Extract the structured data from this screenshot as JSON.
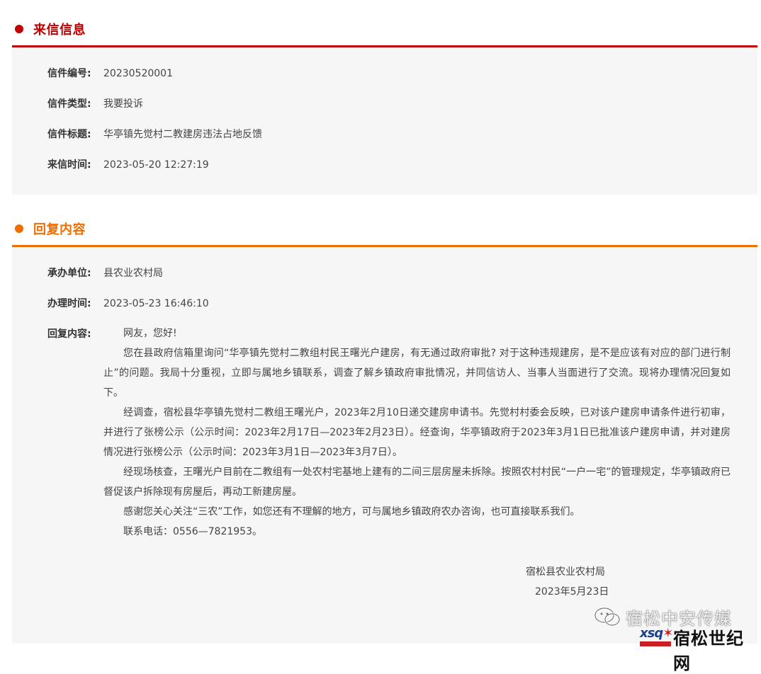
{
  "letter_section": {
    "title": "来信信息",
    "accent": "#c00000",
    "fields": [
      {
        "label": "信件编号:",
        "value": "20230520001"
      },
      {
        "label": "信件类型:",
        "value": "我要投诉"
      },
      {
        "label": "信件标题:",
        "value": "华亭镇先觉村二教建房违法占地反馈"
      },
      {
        "label": "来信时间:",
        "value": "2023-05-20 12:27:19"
      }
    ]
  },
  "reply_section": {
    "title": "回复内容",
    "accent": "#f06d00",
    "fields": [
      {
        "label": "承办单位:",
        "value": "县农业农村局"
      },
      {
        "label": "办理时间:",
        "value": "2023-05-23 16:46:10"
      }
    ],
    "content_label": "回复内容:",
    "paragraphs": [
      "网友，您好!",
      "您在县政府信箱里询问“华亭镇先觉村二教组村民王曙光户建房，有无通过政府审批? 对于这种违规建房，是不是应该有对应的部门进行制止”的问题。我局十分重视，立即与属地乡镇联系，调查了解乡镇政府审批情况，并同信访人、当事人当面进行了交流。现将办理情况回复如下。",
      "经调查，宿松县华亭镇先觉村二教组王曙光户，2023年2月10日递交建房申请书。先觉村村委会反映，已对该户建房申请条件进行初审，并进行了张榜公示（公示时间：2023年2月17日—2023年2月23日）。经查询，华亭镇政府于2023年3月1日已批准该户建房申请，并对建房情况进行张榜公示（公示时间：2023年3月1日—2023年3月7日）。",
      "经现场核查，王曙光户目前在二教组有一处农村宅基地上建有的二间三层房屋未拆除。按照农村村民“一户一宅”的管理规定，华亭镇政府已督促该户拆除现有房屋后，再动工新建房屋。",
      "感谢您关心关注“三农”工作，如您还有不理解的地方，可与属地乡镇政府农办咨询，也可直接联系我们。",
      "联系电话：0556—7821953。"
    ],
    "signature": "宿松县农业农村局",
    "date": "2023年5月23日"
  },
  "watermark": {
    "channel": "宿松中安传媒",
    "logo_abbr": "xsq",
    "logo_name": "宿松世纪网",
    "icon": "wechat-icon"
  }
}
